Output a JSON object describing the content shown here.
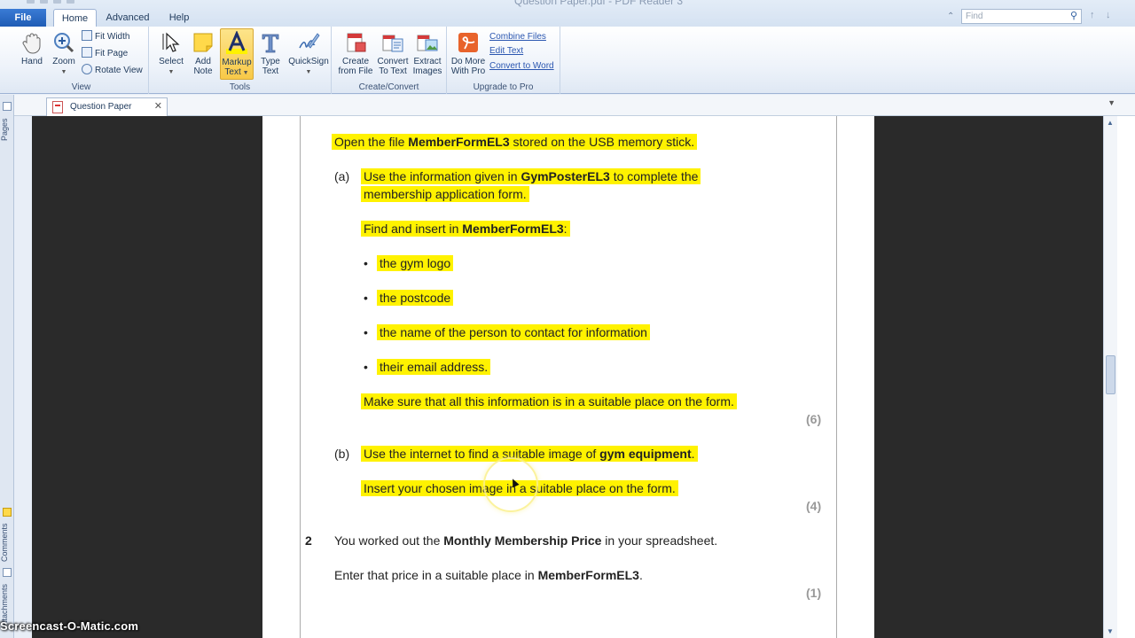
{
  "window": {
    "title": "Question Paper.pdf - PDF Reader 3"
  },
  "ribbon_tabs": [
    {
      "label": "File"
    },
    {
      "label": "Home"
    },
    {
      "label": "Advanced"
    },
    {
      "label": "Help"
    }
  ],
  "find": {
    "placeholder": "Find"
  },
  "ribbon": {
    "view": {
      "label": "View",
      "hand": "Hand",
      "zoom": "Zoom",
      "fit_width": "Fit Width",
      "fit_page": "Fit Page",
      "rotate_view": "Rotate View"
    },
    "tools": {
      "label": "Tools",
      "select": "Select",
      "add_note_1": "Add",
      "add_note_2": "Note",
      "markup_1": "Markup",
      "markup_2": "Text",
      "type_1": "Type",
      "type_2": "Text",
      "quicksign": "QuickSign"
    },
    "create": {
      "label": "Create/Convert",
      "create_1": "Create",
      "create_2": "from File",
      "convert_1": "Convert",
      "convert_2": "To Text",
      "extract_1": "Extract",
      "extract_2": "Images"
    },
    "pro": {
      "label": "Upgrade to Pro",
      "more_1": "Do More",
      "more_2": "With Pro",
      "combine": "Combine Files",
      "edit": "Edit Text",
      "convert_word": "Convert to Word"
    }
  },
  "document_tab": {
    "label": "Question Paper"
  },
  "side_pane": {
    "pages": "Pages",
    "comments": "Comments",
    "attachments": "Attachments"
  },
  "document": {
    "intro": {
      "pre": "Open the file ",
      "b": "MemberFormEL3",
      "post": " stored on the USB memory stick."
    },
    "a_label": "(a)",
    "a_line1": {
      "pre": "Use the information given in ",
      "b": "GymPosterEL3",
      "post": " to complete the"
    },
    "a_line2": "membership application form.",
    "find_insert": {
      "pre": "Find and insert in ",
      "b": "MemberFormEL3",
      "post": ":"
    },
    "bullets": [
      "the gym logo",
      "the postcode",
      "the name of the person to contact for information",
      "their email address."
    ],
    "make_sure": "Make sure that all this information is in a suitable place on the form.",
    "mark_a": "(6)",
    "b_label": "(b)",
    "b_line1": {
      "pre": "Use the internet to find a suitable image of ",
      "b": "gym equipment",
      "post": "."
    },
    "b_line2": "Insert your chosen image in a suitable place on the form.",
    "mark_b": "(4)",
    "q2_num": "2",
    "q2_line1": {
      "pre": "You worked out the ",
      "b": "Monthly Membership Price",
      "post": " in your spreadsheet."
    },
    "q2_line2": {
      "pre": "Enter that price in a suitable place in ",
      "b": "MemberFormEL3",
      "post": "."
    },
    "mark_2": "(1)"
  },
  "watermark": "Screencast-O-Matic.com",
  "colors": {
    "highlight": "#fff200",
    "file_tab": "#2a6bc8",
    "viewer_bg": "#2a2a2a"
  }
}
